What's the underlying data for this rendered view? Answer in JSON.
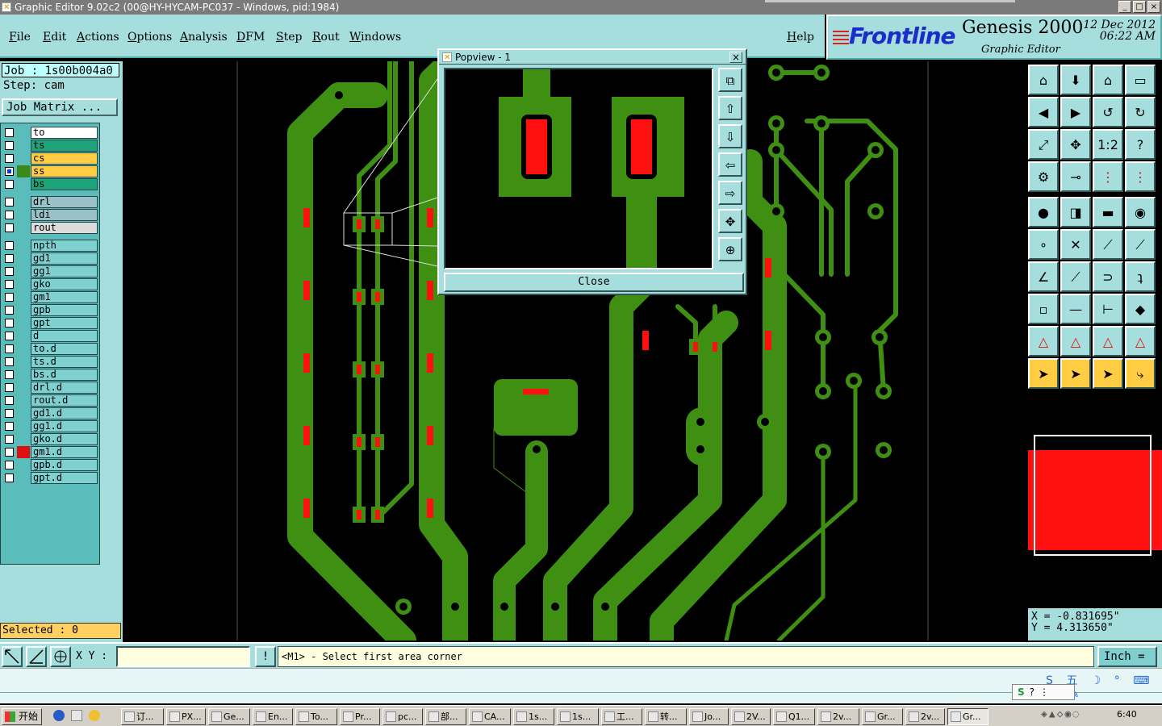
{
  "window": {
    "title": "Graphic Editor 9.02c2 (00@HY-HYCAM-PC037 - Windows, pid:1984)",
    "controls": [
      "_",
      "□",
      "×"
    ]
  },
  "menubar": {
    "items": [
      "File",
      "Edit",
      "Actions",
      "Options",
      "Analysis",
      "DFM",
      "Step",
      "Rout",
      "Windows"
    ],
    "help": "Help"
  },
  "logo": {
    "brand": "Frontline",
    "product": "Genesis 2000",
    "subtitle": "Graphic Editor",
    "date": "12 Dec 2012",
    "time": "06:22 AM"
  },
  "job": {
    "job_line": "Job : 1s00b004a0",
    "step_line": "Step: cam",
    "job_matrix": "Job Matrix ..."
  },
  "layers": [
    {
      "name": "to",
      "color": "#ffffff",
      "swatch": "",
      "checked": false
    },
    {
      "name": "ts",
      "color": "#1fa37a",
      "swatch": "",
      "checked": false
    },
    {
      "name": "cs",
      "color": "#ffcc44",
      "swatch": "",
      "checked": false
    },
    {
      "name": "ss",
      "color": "#ffcc44",
      "swatch": "#3a8a1a",
      "checked": true
    },
    {
      "name": "bs",
      "color": "#1fa37a",
      "swatch": "",
      "checked": false
    },
    {
      "name": "drl",
      "color": "#9cc0c8",
      "swatch": "",
      "checked": false
    },
    {
      "name": "ldi",
      "color": "#9cc0c8",
      "swatch": "",
      "checked": false
    },
    {
      "name": "rout",
      "color": "#dcdcdc",
      "swatch": "",
      "checked": false
    },
    {
      "name": "npth",
      "color": "#7fd0d0",
      "swatch": "",
      "checked": false
    },
    {
      "name": "gd1",
      "color": "#7fd0d0",
      "swatch": "",
      "checked": false
    },
    {
      "name": "gg1",
      "color": "#7fd0d0",
      "swatch": "",
      "checked": false
    },
    {
      "name": "gko",
      "color": "#7fd0d0",
      "swatch": "",
      "checked": false
    },
    {
      "name": "gm1",
      "color": "#7fd0d0",
      "swatch": "",
      "checked": false
    },
    {
      "name": "gpb",
      "color": "#7fd0d0",
      "swatch": "",
      "checked": false
    },
    {
      "name": "gpt",
      "color": "#7fd0d0",
      "swatch": "",
      "checked": false
    },
    {
      "name": "d",
      "color": "#7fd0d0",
      "swatch": "",
      "checked": false
    },
    {
      "name": "to.d",
      "color": "#7fd0d0",
      "swatch": "",
      "checked": false
    },
    {
      "name": "ts.d",
      "color": "#7fd0d0",
      "swatch": "",
      "checked": false
    },
    {
      "name": "bs.d",
      "color": "#7fd0d0",
      "swatch": "",
      "checked": false
    },
    {
      "name": "drl.d",
      "color": "#7fd0d0",
      "swatch": "",
      "checked": false
    },
    {
      "name": "rout.d",
      "color": "#7fd0d0",
      "swatch": "",
      "checked": false
    },
    {
      "name": "gd1.d",
      "color": "#7fd0d0",
      "swatch": "",
      "checked": false
    },
    {
      "name": "gg1.d",
      "color": "#7fd0d0",
      "swatch": "",
      "checked": false
    },
    {
      "name": "gko.d",
      "color": "#7fd0d0",
      "swatch": "",
      "checked": false
    },
    {
      "name": "gm1.d",
      "color": "#7fd0d0",
      "swatch": "#e01010",
      "checked": false
    },
    {
      "name": "gpb.d",
      "color": "#7fd0d0",
      "swatch": "",
      "checked": false
    },
    {
      "name": "gpt.d",
      "color": "#7fd0d0",
      "swatch": "",
      "checked": false
    }
  ],
  "selected": "Selected : 0",
  "colors": {
    "board_green": "#3e8f12",
    "pad_red": "#ff1010",
    "panel_cyan": "#a6dede",
    "status_yellow": "#ffd060"
  },
  "popview": {
    "title": "Popview - 1",
    "close_label": "Close",
    "close_x": "×"
  },
  "coords": {
    "x": "X = -0.831695\"",
    "y": "Y = 4.313650\""
  },
  "cmdbar": {
    "xy_label": "X Y :",
    "xy_value": "",
    "alert": "!",
    "prompt": "<M1> - Select first area corner",
    "unit": "Inch ="
  },
  "ime": {
    "tools": "S 五 ☽ ° ⌨ ▣ ✎",
    "box": [
      "S",
      "?",
      "⋮"
    ]
  },
  "taskbar": {
    "start": "开始",
    "tasks": [
      "订...",
      "PX...",
      "Ge...",
      "En...",
      "To...",
      "Pr...",
      "pc...",
      "部...",
      "CA...",
      "1s...",
      "1s...",
      "工...",
      "转...",
      "Jo...",
      "2V...",
      "Q1...",
      "2v...",
      "Gr...",
      "2v...",
      "Gr..."
    ],
    "clock": "6:40"
  }
}
